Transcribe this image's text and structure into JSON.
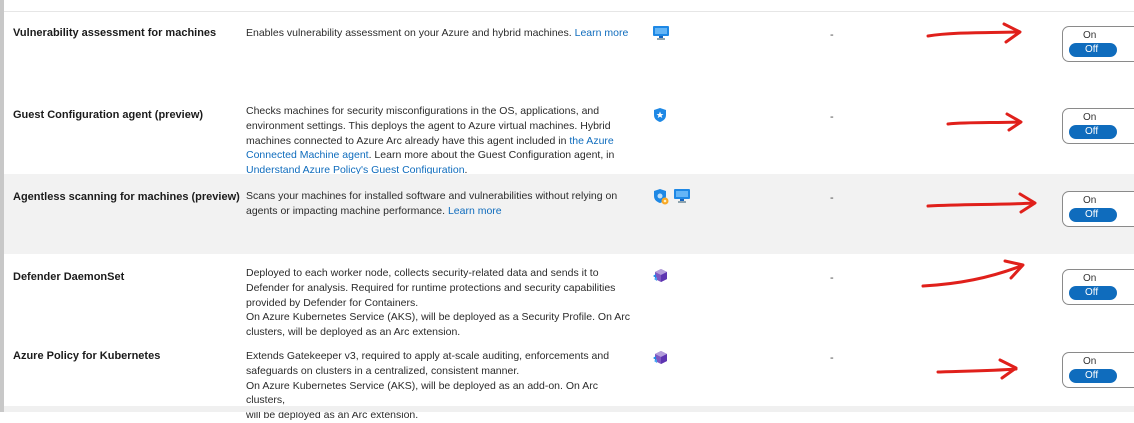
{
  "rows": [
    {
      "name": "Vulnerability assessment for machines",
      "desc": "Enables vulnerability assessment on your Azure and hybrid machines.",
      "link": "Learn more",
      "value": "-",
      "toggle": {
        "on": "On",
        "off": "Off",
        "selected": "Off"
      }
    },
    {
      "name": "Guest Configuration agent (preview)",
      "desc_lines": [
        "Checks machines for security misconfigurations in the OS, applications, and",
        "environment settings. This deploys the agent to Azure virtual machines. Hybrid",
        "machines connected to Azure Arc already have this agent included in",
        "the Azure",
        "Connected Machine agent",
        ". Learn more about the Guest Configuration agent, in",
        "Understand Azure Policy's Guest Configuration",
        "."
      ],
      "value": "-",
      "toggle": {
        "on": "On",
        "off": "Off",
        "selected": "Off"
      }
    },
    {
      "name": "Agentless scanning for machines (preview)",
      "desc_lines": [
        "Scans your machines for installed software and vulnerabilities without relying on",
        "agents or impacting machine performance."
      ],
      "link": "Learn more",
      "value": "-",
      "toggle": {
        "on": "On",
        "off": "Off",
        "selected": "Off"
      }
    },
    {
      "name": "Defender DaemonSet",
      "desc_lines": [
        "Deployed to each worker node, collects security-related data and sends it to",
        "Defender for analysis. Required for runtime protections and security capabilities",
        "provided by Defender for Containers.",
        "On Azure Kubernetes Service (AKS), will be deployed as a Security Profile. On Arc",
        "clusters, will be deployed as an Arc extension."
      ],
      "value": "-",
      "toggle": {
        "on": "On",
        "off": "Off",
        "selected": "Off"
      }
    },
    {
      "name": "Azure Policy for Kubernetes",
      "desc_lines": [
        "Extends Gatekeeper v3, required to apply at-scale auditing, enforcements and",
        "safeguards on clusters in a centralized, consistent manner.",
        "On Azure Kubernetes Service (AKS), will be deployed as an add-on. On Arc clusters,",
        "will be deployed as an Arc extension."
      ],
      "value": "-",
      "toggle": {
        "on": "On",
        "off": "Off",
        "selected": "Off"
      }
    }
  ],
  "icons": {
    "row1": [
      "monitor-icon"
    ],
    "row2": [
      "shield-star-icon"
    ],
    "row3": [
      "shield-gear-icon",
      "monitor-icon"
    ],
    "row4": [
      "kubernetes-cube-icon"
    ],
    "row5": [
      "kubernetes-cube-icon"
    ]
  },
  "colors": {
    "link": "#0f6cbd",
    "toggle_selected": "#0f6cbd",
    "annotation_arrow": "#e0201b",
    "row_highlight": "#f2f2f2"
  }
}
